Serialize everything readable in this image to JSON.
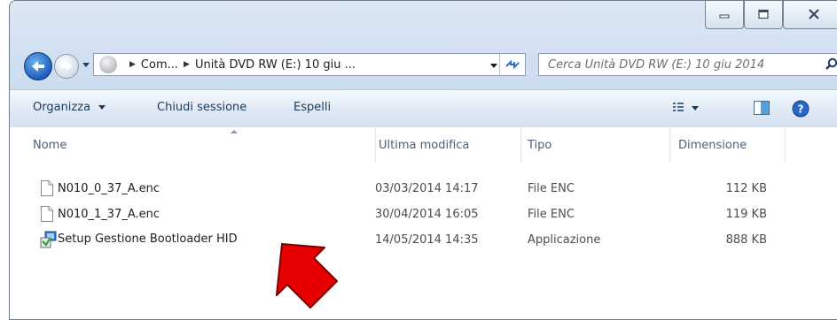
{
  "window": {
    "caption_buttons": [
      "minimize-icon",
      "maximize-icon",
      "close-icon"
    ]
  },
  "address_bar": {
    "crumbs": [
      "Com...",
      "Unità DVD RW (E:) 10 giu ..."
    ]
  },
  "search": {
    "placeholder": "Cerca Unità DVD RW (E:) 10 giu 2014"
  },
  "toolbar": {
    "organize_label": "Organizza",
    "close_session_label": "Chiudi sessione",
    "eject_label": "Espelli"
  },
  "columns": {
    "name": "Nome",
    "modified": "Ultima modifica",
    "type": "Tipo",
    "size": "Dimensione"
  },
  "files": [
    {
      "name": "N010_0_37_A.enc",
      "modified": "03/03/2014 14:17",
      "type": "File ENC",
      "size": "112 KB",
      "icon": "document-icon"
    },
    {
      "name": "N010_1_37_A.enc",
      "modified": "30/04/2014 16:05",
      "type": "File ENC",
      "size": "119 KB",
      "icon": "document-icon"
    },
    {
      "name": "Setup Gestione Bootloader HID",
      "modified": "14/05/2014 14:35",
      "type": "Applicazione",
      "size": "888 KB",
      "icon": "setup-installer-icon"
    }
  ],
  "colors": {
    "annotation_arrow": "#e60000"
  }
}
